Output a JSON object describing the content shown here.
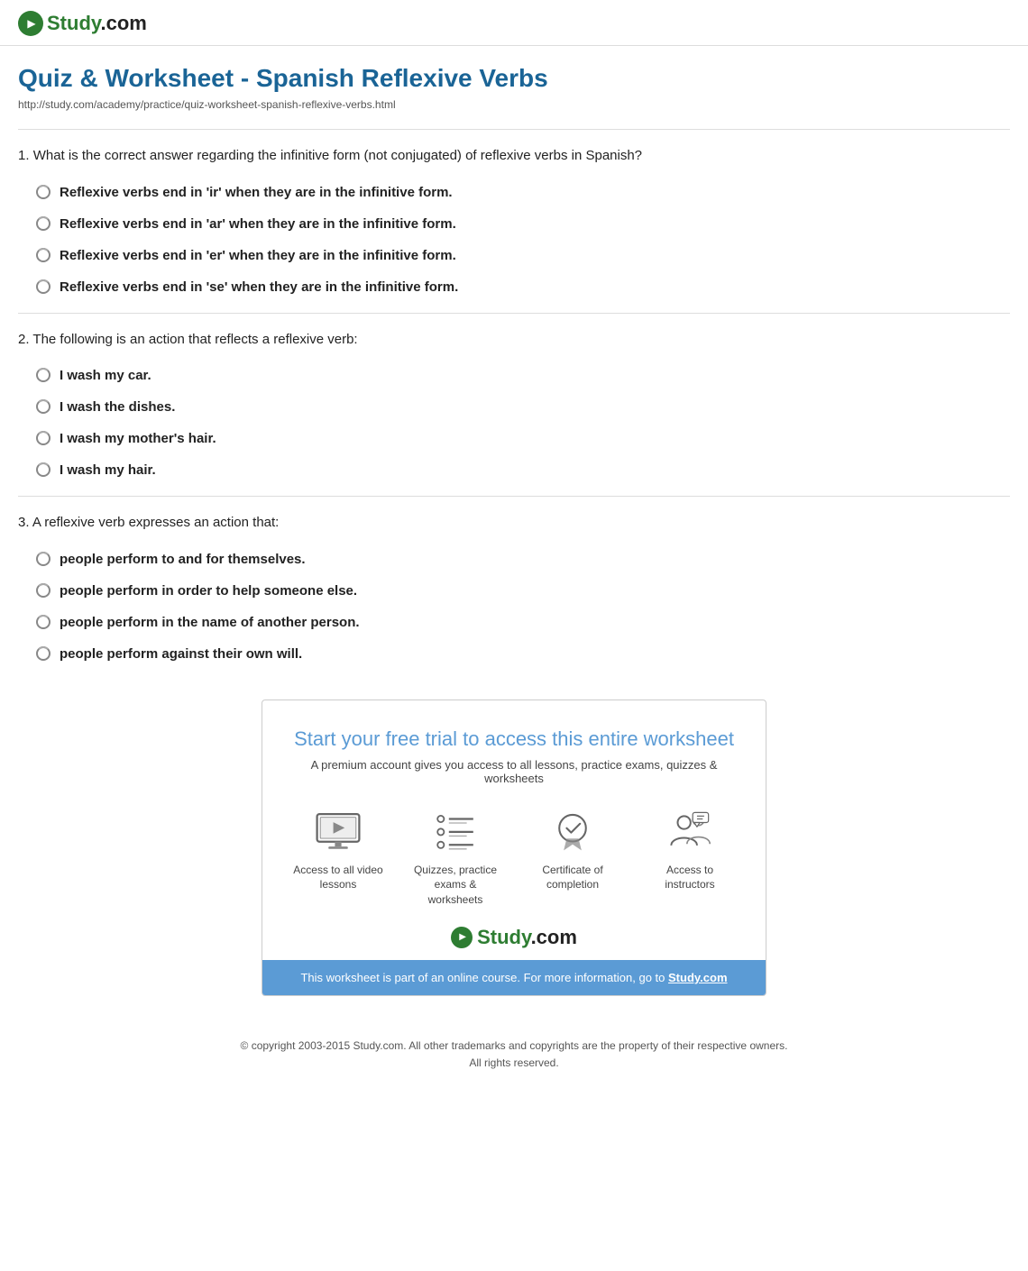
{
  "header": {
    "logo_text": "Study",
    "logo_domain": ".com"
  },
  "page": {
    "title": "Quiz & Worksheet - Spanish Reflexive Verbs",
    "url": "http://study.com/academy/practice/quiz-worksheet-spanish-reflexive-verbs.html"
  },
  "questions": [
    {
      "number": "1",
      "text": "What is the correct answer regarding the infinitive form (not conjugated) of reflexive verbs in Spanish?",
      "options": [
        "Reflexive verbs end in 'ir' when they are in the infinitive form.",
        "Reflexive verbs end in 'ar' when they are in the infinitive form.",
        "Reflexive verbs end in 'er' when they are in the infinitive form.",
        "Reflexive verbs end in 'se' when they are in the infinitive form."
      ]
    },
    {
      "number": "2",
      "text": "The following is an action that reflects a reflexive verb:",
      "options": [
        "I wash my car.",
        "I wash the dishes.",
        "I wash my mother's hair.",
        "I wash my hair."
      ]
    },
    {
      "number": "3",
      "text": "A reflexive verb expresses an action that:",
      "options": [
        "people perform to and for themselves.",
        "people perform in order to help someone else.",
        "people perform in the name of another person.",
        "people perform against their own will."
      ]
    }
  ],
  "cta": {
    "title": "Start your free trial to access this entire worksheet",
    "subtitle": "A premium account gives you access to all lessons, practice exams, quizzes & worksheets",
    "features": [
      {
        "id": "video",
        "label": "Access to all video lessons"
      },
      {
        "id": "quizzes",
        "label": "Quizzes, practice exams & worksheets"
      },
      {
        "id": "certificate",
        "label": "Certificate of completion"
      },
      {
        "id": "instructors",
        "label": "Access to instructors"
      }
    ],
    "logo_text": "Study",
    "logo_domain": ".com",
    "footer_text": "This worksheet is part of an online course. For more information, go to",
    "footer_link": "Study.com"
  },
  "copyright": {
    "line1": "© copyright 2003-2015 Study.com. All other trademarks and copyrights are the property of their respective owners.",
    "line2": "All rights reserved."
  }
}
